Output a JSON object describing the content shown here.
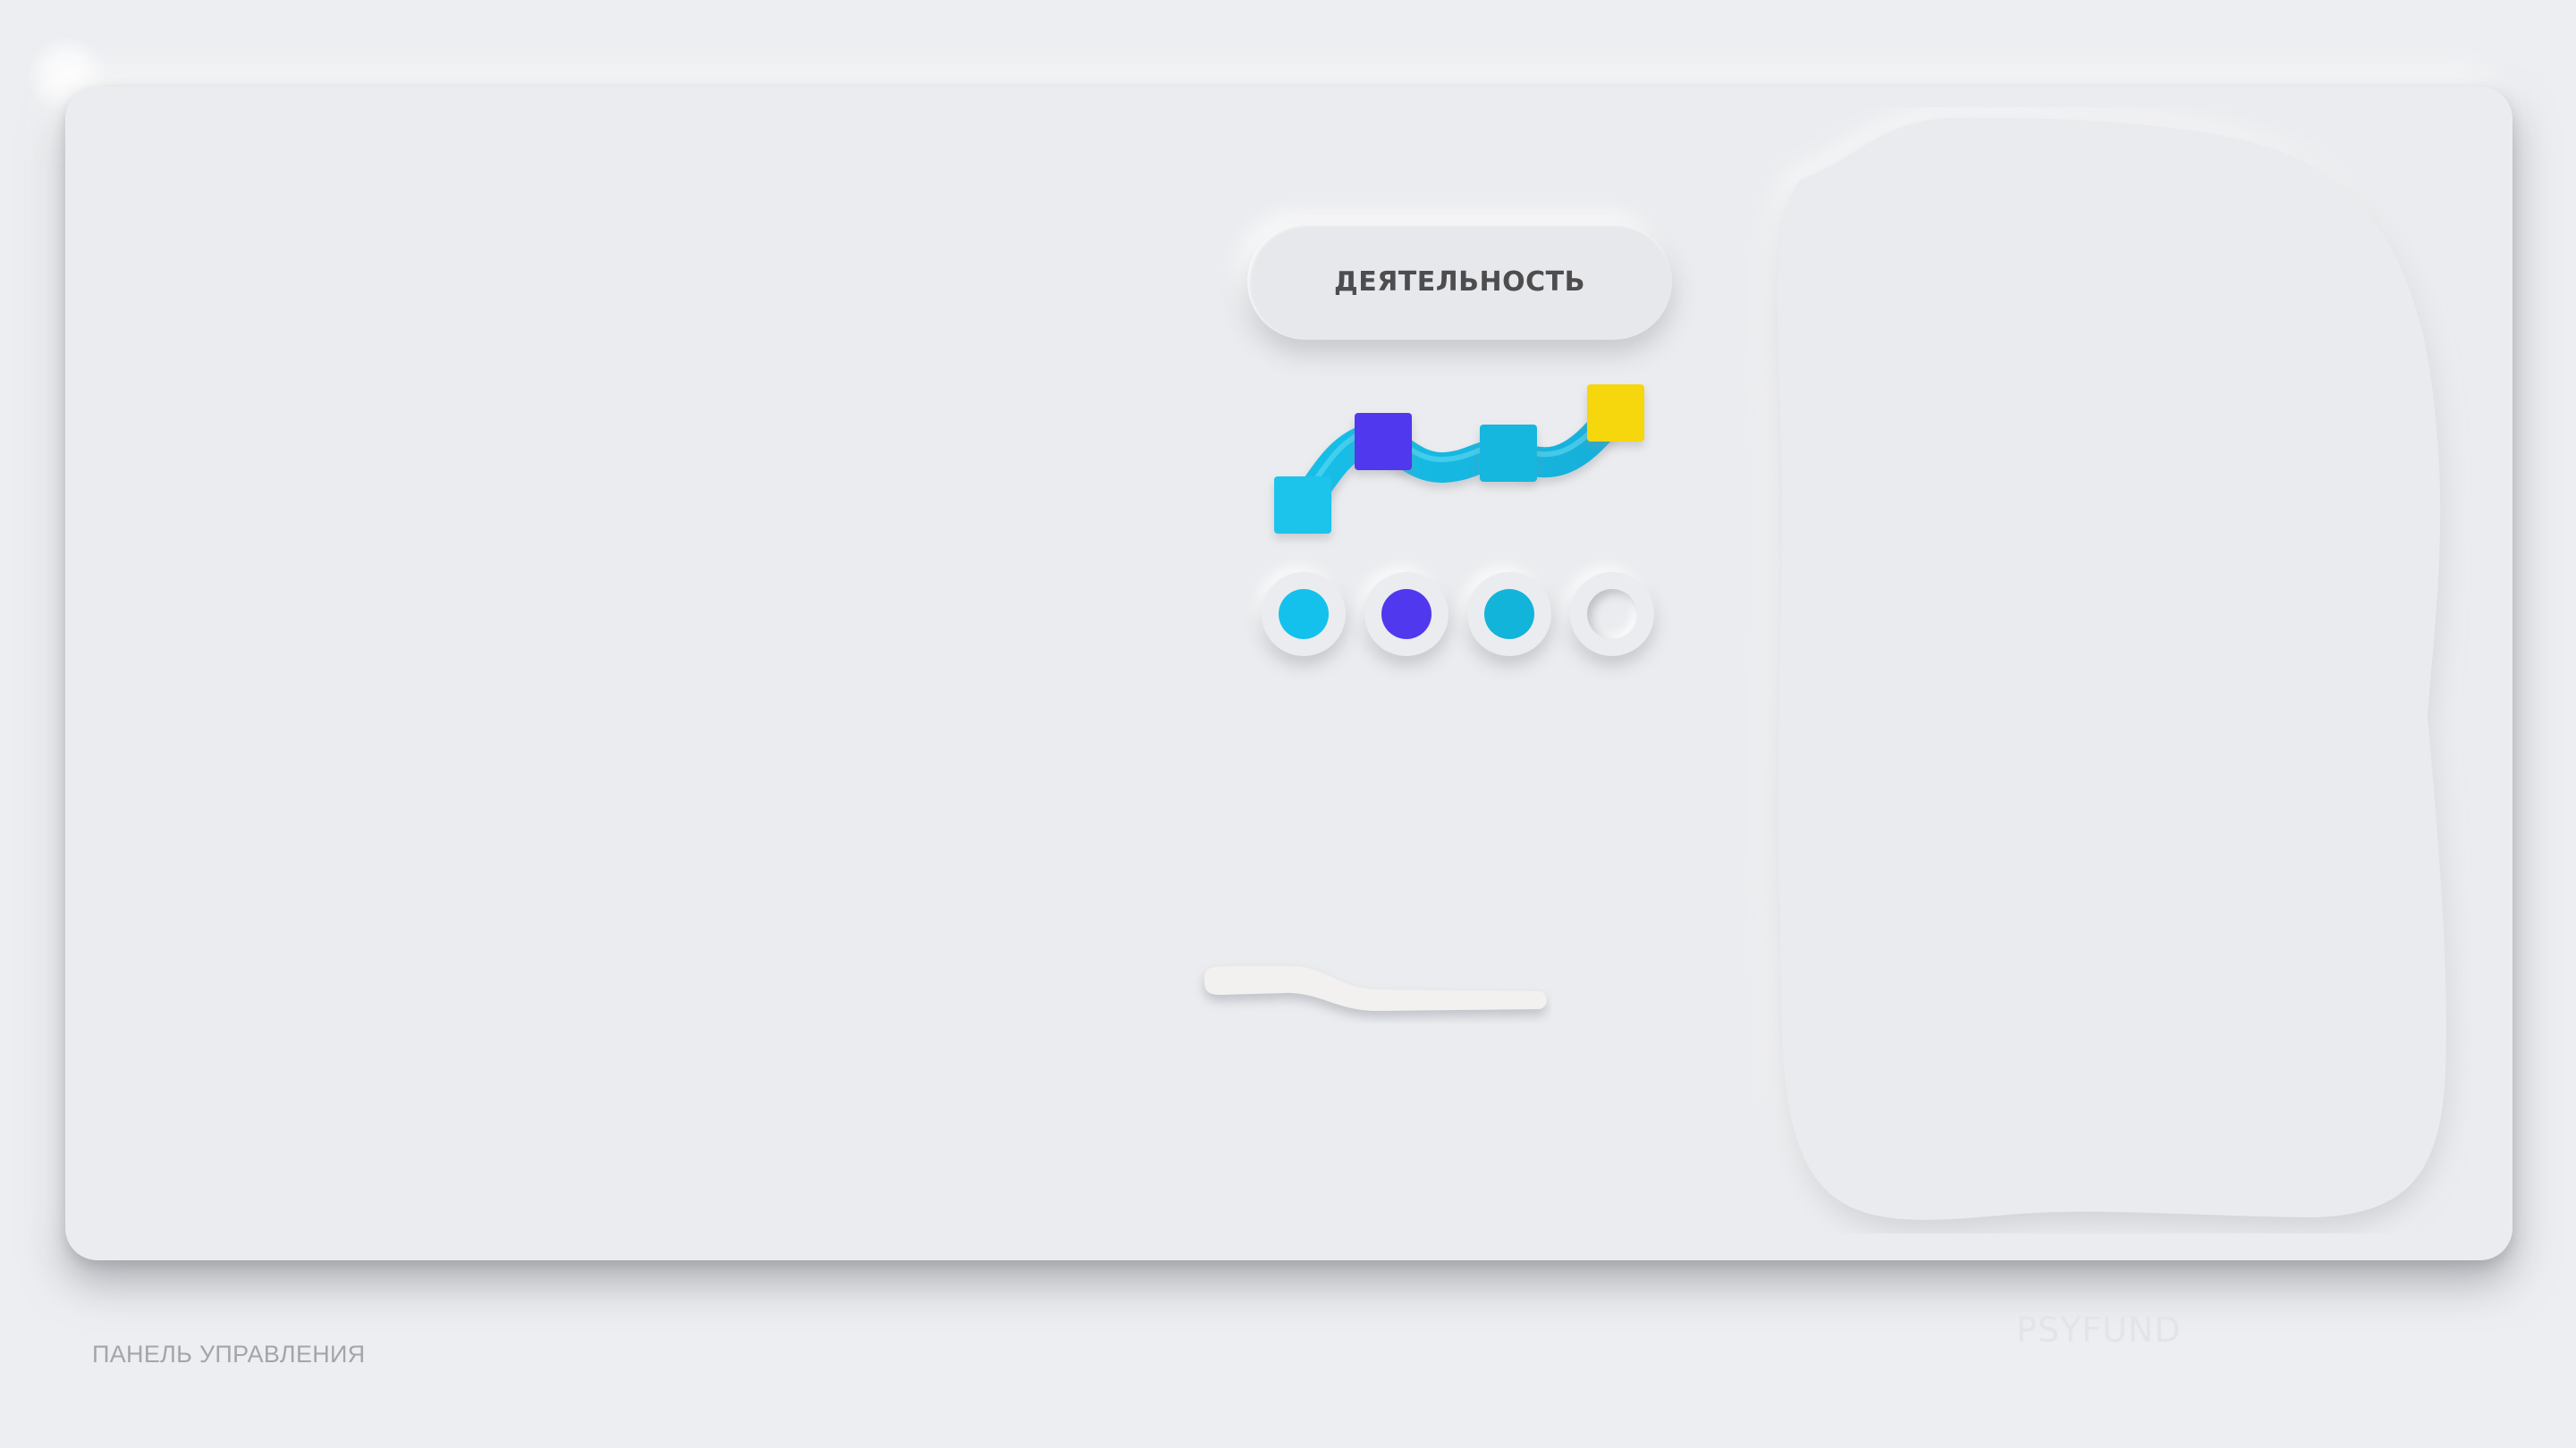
{
  "activity_button": {
    "label": "ДЕЯТЕЛЬНОСТЬ"
  },
  "path_graphic": {
    "icon": "activity-path-icon",
    "colors": {
      "ribbon": "#1cc3e6",
      "step_1": "#1cc3ea",
      "step_2": "#5038ee",
      "step_3": "#16b7de",
      "step_4": "#f6d60a"
    }
  },
  "steps": [
    {
      "color": "#14c1ec",
      "filled": true
    },
    {
      "color": "#5038ee",
      "filled": true
    },
    {
      "color": "#12b4da",
      "filled": true
    },
    {
      "color": "",
      "filled": false
    }
  ],
  "footer": {
    "label": "ПАНЕЛЬ УПРАВЛЕНИЯ",
    "brand": "PSYFUND"
  }
}
